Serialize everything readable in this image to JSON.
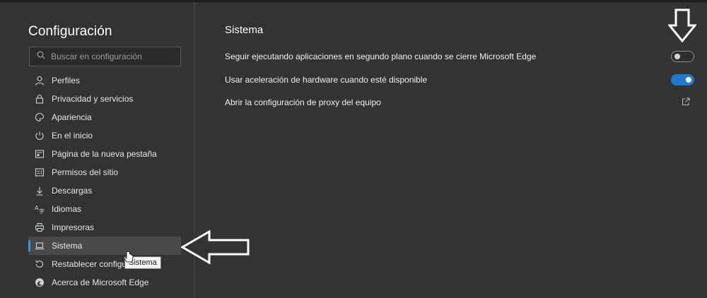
{
  "sidebar": {
    "title": "Configuración",
    "search_placeholder": "Buscar en configuración",
    "items": [
      {
        "label": "Perfiles",
        "icon": "person-icon"
      },
      {
        "label": "Privacidad y servicios",
        "icon": "lock-icon"
      },
      {
        "label": "Apariencia",
        "icon": "palette-icon"
      },
      {
        "label": "En el inicio",
        "icon": "power-icon"
      },
      {
        "label": "Página de la nueva pestaña",
        "icon": "new-tab-icon"
      },
      {
        "label": "Permisos del sitio",
        "icon": "site-permissions-icon"
      },
      {
        "label": "Descargas",
        "icon": "download-icon"
      },
      {
        "label": "Idiomas",
        "icon": "languages-icon"
      },
      {
        "label": "Impresoras",
        "icon": "printer-icon"
      },
      {
        "label": "Sistema",
        "icon": "laptop-icon",
        "active": true
      },
      {
        "label": "Restablecer configu",
        "icon": "reset-icon"
      },
      {
        "label": "Acerca de Microsoft Edge",
        "icon": "edge-icon"
      }
    ]
  },
  "tooltip": "Sistema",
  "main": {
    "title": "Sistema",
    "settings": [
      {
        "label": "Seguir ejecutando aplicaciones en segundo plano cuando se cierre Microsoft Edge",
        "control": "toggle",
        "state": "off"
      },
      {
        "label": "Usar aceleración de hardware cuando esté disponible",
        "control": "toggle",
        "state": "on"
      },
      {
        "label": "Abrir la configuración de proxy del equipo",
        "control": "external-link"
      }
    ]
  },
  "colors": {
    "background": "#333333",
    "accent": "#1f7bd1",
    "active_indicator": "#3a96dd"
  }
}
